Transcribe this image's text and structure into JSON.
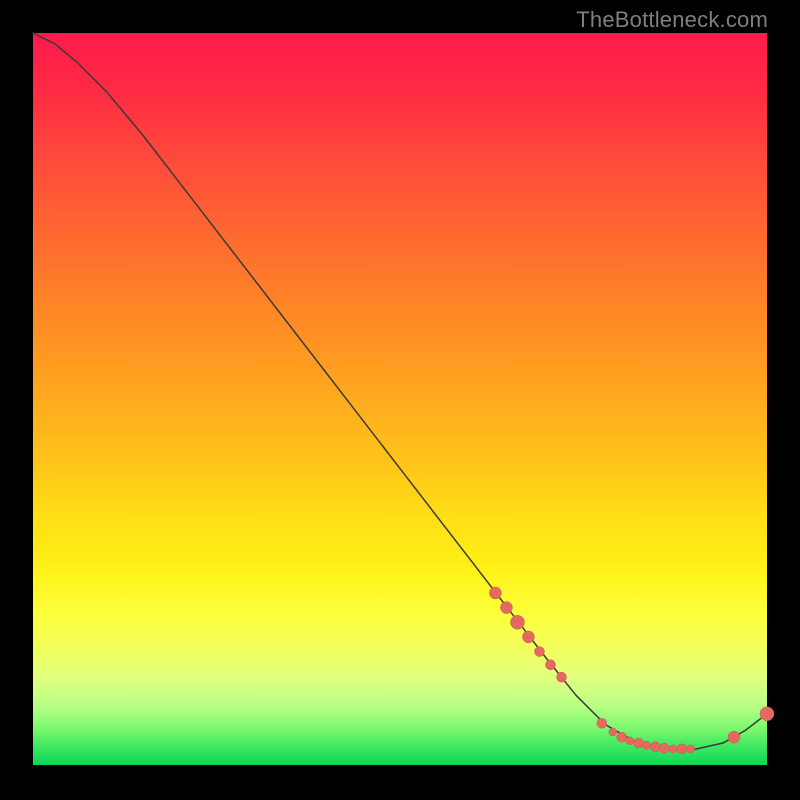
{
  "watermark": "TheBottleneck.com",
  "chart_data": {
    "type": "line",
    "title": "",
    "xlabel": "",
    "ylabel": "",
    "xlim": [
      0,
      100
    ],
    "ylim": [
      0,
      100
    ],
    "grid": false,
    "legend": false,
    "series": [
      {
        "name": "curve",
        "x": [
          0,
          3,
          6,
          10,
          15,
          20,
          30,
          40,
          50,
          60,
          70,
          74,
          78,
          82,
          86,
          90,
          94,
          97,
          100
        ],
        "y": [
          100,
          98.5,
          96,
          92,
          86,
          79.5,
          66.5,
          53.5,
          40.5,
          27.5,
          14.5,
          9.5,
          5.5,
          3.2,
          2.3,
          2.1,
          3.0,
          4.7,
          7.0
        ]
      }
    ],
    "markers": [
      {
        "name": "dots",
        "points": [
          {
            "x": 63,
            "y": 23.5,
            "r": 6
          },
          {
            "x": 64.5,
            "y": 21.5,
            "r": 6
          },
          {
            "x": 66,
            "y": 19.5,
            "r": 7
          },
          {
            "x": 67.5,
            "y": 17.5,
            "r": 6
          },
          {
            "x": 69,
            "y": 15.5,
            "r": 5
          },
          {
            "x": 70.5,
            "y": 13.7,
            "r": 5
          },
          {
            "x": 72,
            "y": 12.0,
            "r": 5
          },
          {
            "x": 77.5,
            "y": 5.7,
            "r": 5
          },
          {
            "x": 79.0,
            "y": 4.5,
            "r": 4
          },
          {
            "x": 80.2,
            "y": 3.8,
            "r": 5
          },
          {
            "x": 81.3,
            "y": 3.3,
            "r": 4
          },
          {
            "x": 82.5,
            "y": 3.0,
            "r": 5
          },
          {
            "x": 83.6,
            "y": 2.7,
            "r": 4
          },
          {
            "x": 84.8,
            "y": 2.5,
            "r": 5
          },
          {
            "x": 86.0,
            "y": 2.3,
            "r": 5
          },
          {
            "x": 87.2,
            "y": 2.2,
            "r": 4
          },
          {
            "x": 88.4,
            "y": 2.2,
            "r": 5
          },
          {
            "x": 89.6,
            "y": 2.2,
            "r": 4
          },
          {
            "x": 95.5,
            "y": 3.8,
            "r": 6
          },
          {
            "x": 100.0,
            "y": 7.0,
            "r": 7
          }
        ]
      }
    ]
  }
}
